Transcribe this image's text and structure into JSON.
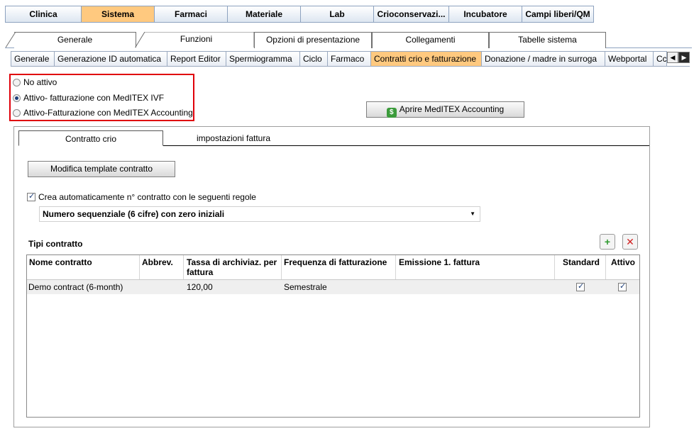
{
  "top_tabs": [
    {
      "label": "Clinica"
    },
    {
      "label": "Sistema"
    },
    {
      "label": "Farmaci"
    },
    {
      "label": "Materiale"
    },
    {
      "label": "Lab"
    },
    {
      "label": "Crioconservazi..."
    },
    {
      "label": "Incubatore"
    },
    {
      "label": "Campi liberi/QM"
    }
  ],
  "sub_tabs": [
    {
      "label": "Generale"
    },
    {
      "label": "Funzioni"
    },
    {
      "label": "Opzioni di presentazione"
    },
    {
      "label": "Collegamenti"
    },
    {
      "label": "Tabelle sistema"
    }
  ],
  "third_tabs": [
    {
      "label": "Generale"
    },
    {
      "label": "Generazione ID automatica"
    },
    {
      "label": "Report Editor"
    },
    {
      "label": "Spermiogramma"
    },
    {
      "label": "Ciclo"
    },
    {
      "label": "Farmaco"
    },
    {
      "label": "Contratti crio e fatturazione"
    },
    {
      "label": "Donazione / madre in surroga"
    },
    {
      "label": "Webportal"
    },
    {
      "label": "Cc"
    }
  ],
  "radio_options": [
    {
      "label": "No attivo"
    },
    {
      "label": "Attivo- fatturazione con MedITEX IVF"
    },
    {
      "label": "Attivo-Fatturazione con MedITEX Accounting"
    }
  ],
  "open_accounting_button": "Aprire MedITEX Accounting",
  "inner_tabs": [
    {
      "label": "Contratto crio"
    },
    {
      "label": "impostazioni fattura"
    }
  ],
  "edit_template_button": "Modifica template contratto",
  "auto_number_label": "Crea automaticamente n° contratto con le seguenti regole",
  "numbering_select_value": "Numero sequenziale (6 cifre) con zero iniziali",
  "contract_types_title": "Tipi contratto",
  "table": {
    "headers": [
      "Nome contratto",
      "Abbrev.",
      "Tassa di archiviaz. per fattura",
      "Frequenza di fatturazione",
      "Emissione 1. fattura",
      "Standard",
      "Attivo"
    ],
    "rows": [
      {
        "name": "Demo contract (6-month)",
        "abbrev": "",
        "fee": "120,00",
        "frequency": "Semestrale",
        "first_invoice": "",
        "standard": true,
        "active": true
      }
    ]
  }
}
